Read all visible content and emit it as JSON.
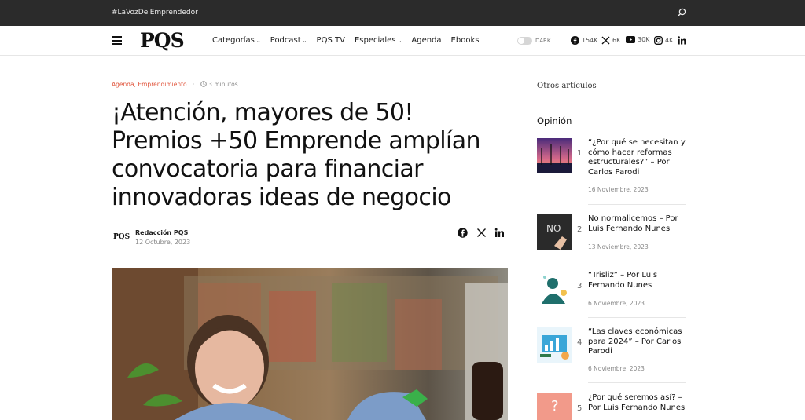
{
  "topbar": {
    "tagline": "#LaVozDelEmprendedor",
    "search_icon": "search-icon"
  },
  "header": {
    "logo": "PQS",
    "menu": [
      {
        "label": "Categorías",
        "dropdown": true
      },
      {
        "label": "Podcast",
        "dropdown": true
      },
      {
        "label": "PQS TV",
        "dropdown": false
      },
      {
        "label": "Especiales",
        "dropdown": true
      },
      {
        "label": "Agenda",
        "dropdown": false
      },
      {
        "label": "Ebooks",
        "dropdown": false
      }
    ],
    "dark_label": "DARK",
    "social": [
      {
        "icon": "facebook-icon",
        "count": "154K"
      },
      {
        "icon": "x-icon",
        "count": "6K"
      },
      {
        "icon": "youtube-icon",
        "count": "30K"
      },
      {
        "icon": "instagram-icon",
        "count": "4K"
      },
      {
        "icon": "linkedin-icon",
        "count": ""
      }
    ]
  },
  "article": {
    "categories": "Agenda, Emprendimiento",
    "read_time": "3 minutos",
    "title": "¡Atención, mayores de 50! Premios +50 Emprende amplían convocatoria para financiar innovadoras ideas de negocio",
    "author_logo": "PQS",
    "author": "Redacción PQS",
    "date": "12 Octubre, 2023",
    "share_icons": [
      "facebook-icon",
      "x-icon",
      "linkedin-icon"
    ]
  },
  "sidebar": {
    "heading": "Otros artículos",
    "section": "Opinión",
    "articles": [
      {
        "num": "1",
        "title": "“¿Por qué se necesitan y cómo hacer reformas estructurales?” – Por Carlos Parodi",
        "date": "16 Noviembre, 2023"
      },
      {
        "num": "2",
        "title": "No normalicemos – Por Luis Fernando Nunes",
        "date": "13 Noviembre, 2023"
      },
      {
        "num": "3",
        "title": "“Trisliz” – Por Luis Fernando Nunes",
        "date": "6 Noviembre, 2023"
      },
      {
        "num": "4",
        "title": "“Las claves económicas para 2024” – Por Carlos Parodi",
        "date": "6 Noviembre, 2023"
      },
      {
        "num": "5",
        "title": "¿Por qué seremos así? – Por Luis Fernando Nunes",
        "date": ""
      }
    ]
  },
  "colors": {
    "topbar": "#2b2b2b",
    "category": "#e0533a"
  }
}
